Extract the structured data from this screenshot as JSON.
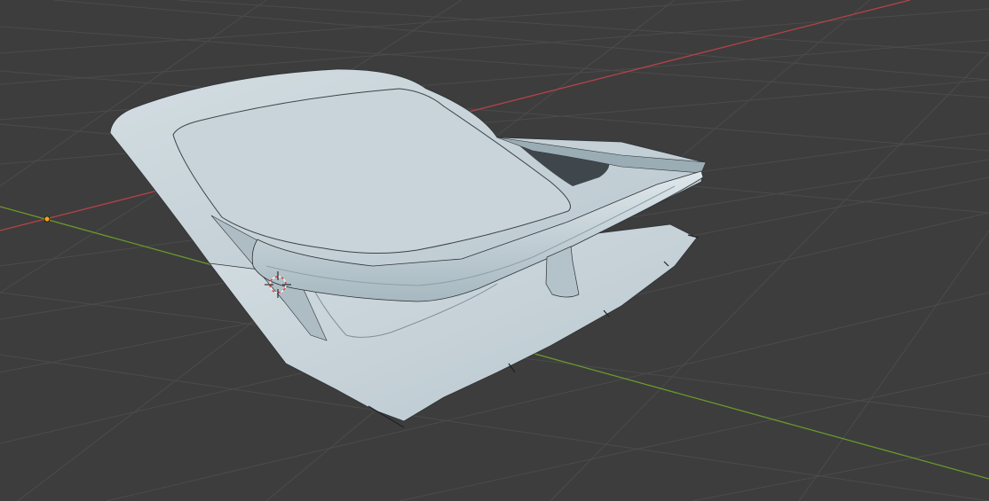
{
  "app": {
    "name": "3D Viewport"
  },
  "viewport": {
    "background_color": "#3d3d3d",
    "grid_color": "#4a4a4a",
    "x_axis_color": "#b5424a",
    "y_axis_color": "#6b9a2a",
    "origin_marker_color": "#f5a31a",
    "mesh_color": "#c5d1d6",
    "mesh_shadow_color": "#9fb0b8",
    "mesh_outline_color": "#2e3336",
    "cursor_color_a": "#d9433b",
    "cursor_color_b": "#f2f2f2"
  },
  "scene": {
    "object_type": "mesh",
    "object_shape": "hood-with-spoiler"
  },
  "icons": {
    "cursor": "3d-cursor-icon",
    "origin": "object-origin-icon"
  }
}
